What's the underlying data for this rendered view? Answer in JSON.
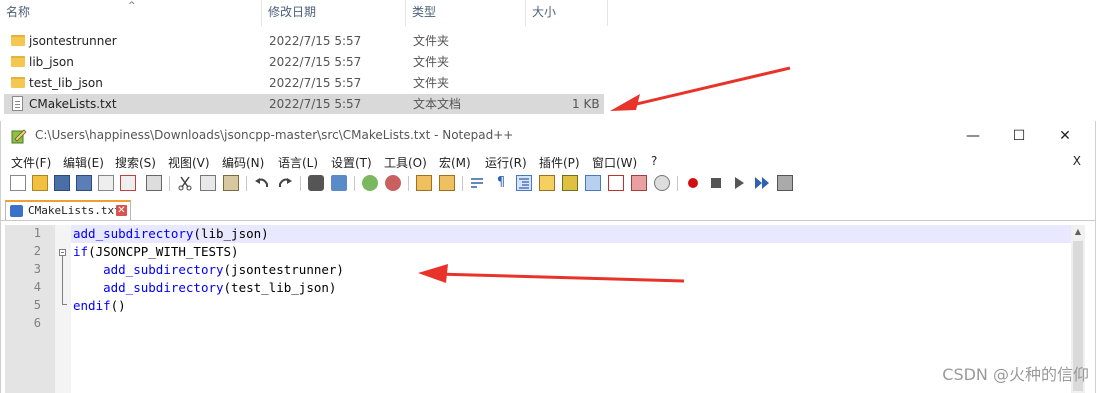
{
  "explorer": {
    "columns": [
      "名称",
      "修改日期",
      "类型",
      "大小"
    ],
    "files": [
      {
        "name": "jsontestrunner",
        "date": "2022/7/15 5:57",
        "type": "文件夹",
        "size": "",
        "icon": "folder-icon",
        "selected": false
      },
      {
        "name": "lib_json",
        "date": "2022/7/15 5:57",
        "type": "文件夹",
        "size": "",
        "icon": "folder-icon",
        "selected": false
      },
      {
        "name": "test_lib_json",
        "date": "2022/7/15 5:57",
        "type": "文件夹",
        "size": "",
        "icon": "folder-icon",
        "selected": false
      },
      {
        "name": "CMakeLists.txt",
        "date": "2022/7/15 5:57",
        "type": "文本文档",
        "size": "1 KB",
        "icon": "text-file-icon",
        "selected": true
      }
    ]
  },
  "notepad": {
    "title": "C:\\Users\\happiness\\Downloads\\jsoncpp-master\\src\\CMakeLists.txt - Notepad++",
    "window_controls": {
      "minimize": "—",
      "maximize": "☐",
      "close": "✕"
    },
    "menu": [
      "文件(F)",
      "编辑(E)",
      "搜索(S)",
      "视图(V)",
      "编码(N)",
      "语言(L)",
      "设置(T)",
      "工具(O)",
      "宏(M)",
      "运行(R)",
      "插件(P)",
      "窗口(W)",
      "?"
    ],
    "menu_close": "X",
    "tab": {
      "label": "CMakeLists.txt",
      "close": "✕"
    },
    "line_numbers": [
      "1",
      "2",
      "3",
      "4",
      "5",
      "6"
    ],
    "code": [
      {
        "parts": [
          {
            "t": "add_subdirectory",
            "c": "kw"
          },
          {
            "t": "(lib_json)",
            "c": "txt"
          }
        ]
      },
      {
        "parts": [
          {
            "t": "if",
            "c": "kw"
          },
          {
            "t": "(JSONCPP_WITH_TESTS)",
            "c": "txt"
          }
        ]
      },
      {
        "parts": [
          {
            "t": "    ",
            "c": "txt"
          },
          {
            "t": "add_subdirectory",
            "c": "kw"
          },
          {
            "t": "(jsontestrunner)",
            "c": "txt"
          }
        ]
      },
      {
        "parts": [
          {
            "t": "    ",
            "c": "txt"
          },
          {
            "t": "add_subdirectory",
            "c": "kw"
          },
          {
            "t": "(test_lib_json)",
            "c": "txt"
          }
        ]
      },
      {
        "parts": [
          {
            "t": "endif",
            "c": "kw"
          },
          {
            "t": "()",
            "c": "txt"
          }
        ]
      },
      {
        "parts": []
      }
    ]
  },
  "watermark": "CSDN @火种的信仰",
  "colors": {
    "annotation_arrow": "#e8332a",
    "keyword": "#0000ff",
    "current_line": "#e8e8ff"
  }
}
